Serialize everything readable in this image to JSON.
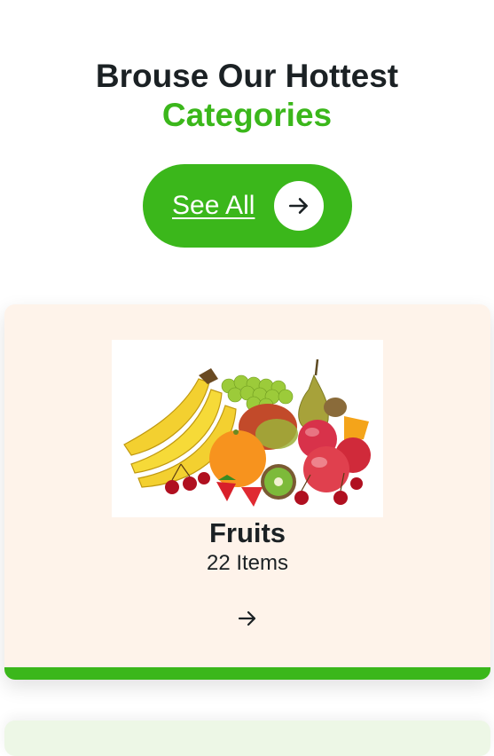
{
  "section": {
    "heading_line1": "Brouse Our Hottest",
    "heading_line2": "Categories",
    "see_all_label": "See All",
    "see_all_icon": "arrow-right-icon"
  },
  "colors": {
    "accent": "#3bb71b",
    "text": "#1b2124",
    "card_bg": "#fef3ea",
    "next_card_bg": "#edf7e6"
  },
  "category": {
    "title": "Fruits",
    "count": "22 Items",
    "image": "fruits-image",
    "arrow_icon": "arrow-right-icon"
  }
}
